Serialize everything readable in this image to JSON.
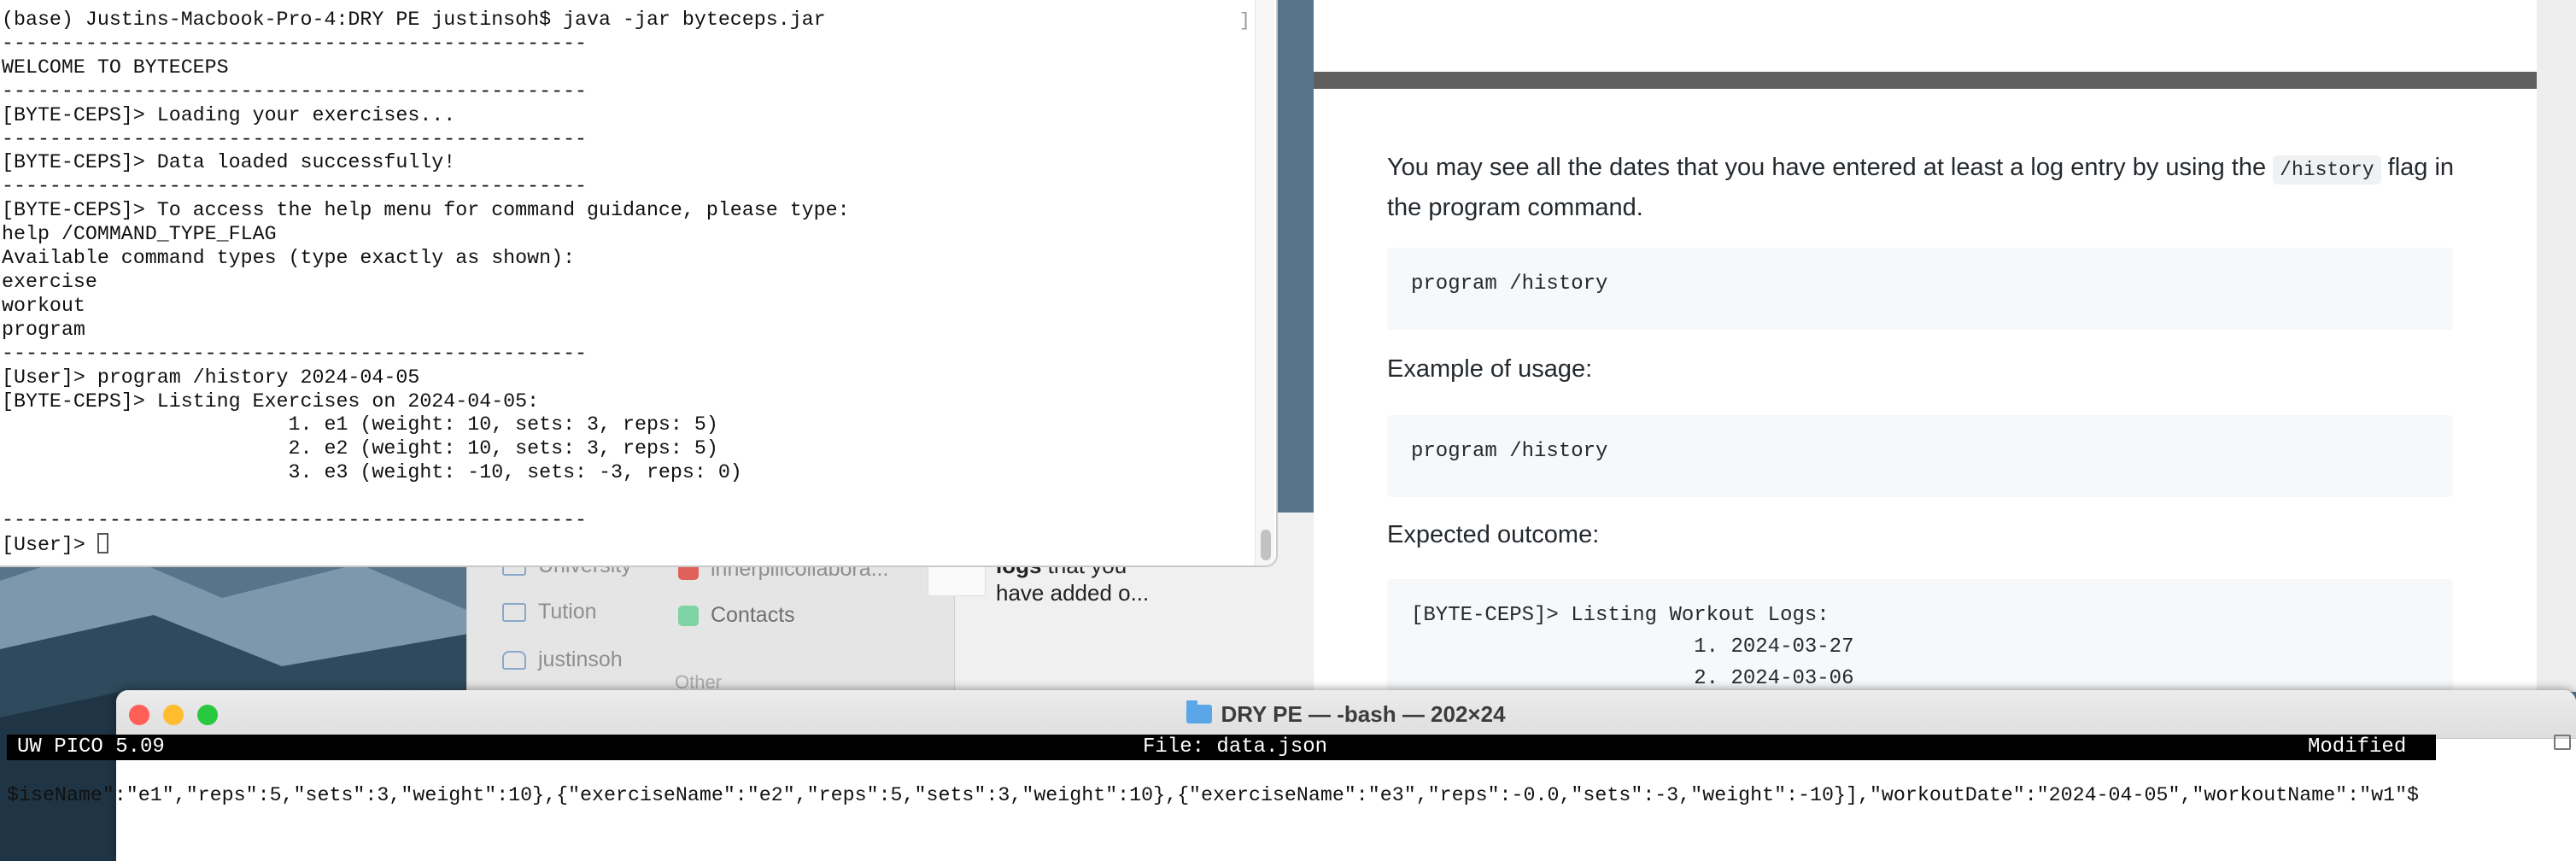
{
  "terminal_top": {
    "lines": [
      "(base) Justins-Macbook-Pro-4:DRY PE justinsoh$ java -jar byteceps.jar",
      "-------------------------------------------------",
      "WELCOME TO BYTECEPS",
      "-------------------------------------------------",
      "[BYTE-CEPS]> Loading your exercises...",
      "-------------------------------------------------",
      "[BYTE-CEPS]> Data loaded successfully!",
      "-------------------------------------------------",
      "[BYTE-CEPS]> To access the help menu for command guidance, please type:",
      "help /COMMAND_TYPE_FLAG",
      "Available command types (type exactly as shown):",
      "exercise",
      "workout",
      "program",
      "-------------------------------------------------",
      "[User]> program /history 2024-04-05",
      "[BYTE-CEPS]> Listing Exercises on 2024-04-05:",
      "                        1. e1 (weight: 10, sets: 3, reps: 5)",
      "                        2. e2 (weight: 10, sets: 3, reps: 5)",
      "                        3. e3 (weight: -10, sets: -3, reps: 0)",
      "",
      "-------------------------------------------------"
    ],
    "prompt": "[User]> "
  },
  "finder": {
    "sidebar_items": [
      "University",
      "Tution",
      "justinsoh"
    ],
    "tags": [
      {
        "label": "innerpilicollabora...",
        "color": "#e0605a"
      },
      {
        "label": "Contacts",
        "color": "#7dd3a4"
      }
    ],
    "section_label": "Other",
    "preview_bold": "logs",
    "preview_rest": " that you",
    "preview_line2": "have added o..."
  },
  "doc": {
    "para1_before": "You may see all the dates that you have entered at least a log entry by using the ",
    "para1_code": "/history",
    "para1_after": " flag in",
    "para1_line2": "the program command.",
    "code1": "program /history",
    "example_label": "Example of usage:",
    "code2": "program /history",
    "outcome_label": "Expected outcome:",
    "code3_lines": [
      "[BYTE-CEPS]> Listing Workout Logs:",
      "                       1. 2024-03-27",
      "                       2. 2024-03-06"
    ]
  },
  "pico_window": {
    "title": "DRY PE — -bash — 202×24",
    "version": "UW PICO 5.09",
    "file": "File: data.json",
    "status": "Modified",
    "content_line": "$iseName\":\"e1\",\"reps\":5,\"sets\":3,\"weight\":10},{\"exerciseName\":\"e2\",\"reps\":5,\"sets\":3,\"weight\":10},{\"exerciseName\":\"e3\",\"reps\":-0.0,\"sets\":-3,\"weight\":-10}],\"workoutDate\":\"2024-04-05\",\"workoutName\":\"w1\"$"
  },
  "colors": {
    "close": "#ff5f57",
    "minimize": "#febc2e",
    "zoom": "#28c840"
  }
}
